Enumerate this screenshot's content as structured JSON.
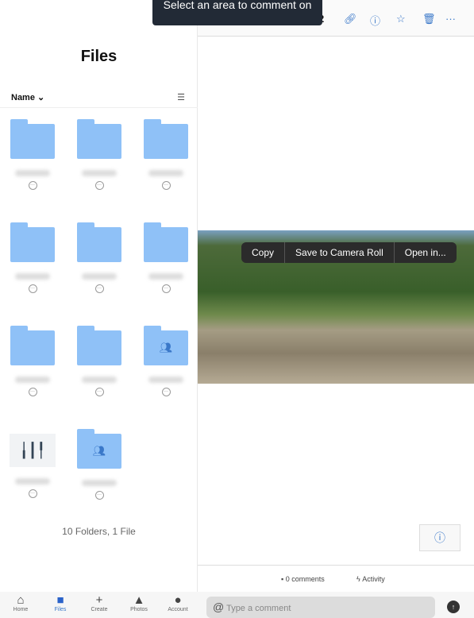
{
  "tooltip": "Select an area to comment on",
  "page_title": "Files",
  "sort_label": "Name ⌄",
  "toolbar_fragment": "2",
  "items": [
    {
      "type": "folder"
    },
    {
      "type": "folder"
    },
    {
      "type": "folder"
    },
    {
      "type": "folder"
    },
    {
      "type": "folder"
    },
    {
      "type": "folder"
    },
    {
      "type": "folder"
    },
    {
      "type": "folder"
    },
    {
      "type": "shared-folder"
    },
    {
      "type": "audio-file"
    },
    {
      "type": "shared-folder"
    }
  ],
  "count": "10 Folders, 1 File",
  "context_menu": [
    "Copy",
    "Save to Camera Roll",
    "Open in..."
  ],
  "footer": {
    "comments": "0 comments",
    "activity": "Activity"
  },
  "comment_placeholder": "Type a comment",
  "tabs": [
    "Home",
    "Files",
    "Create",
    "Photos",
    "Account"
  ],
  "accent": "#3a78c9"
}
